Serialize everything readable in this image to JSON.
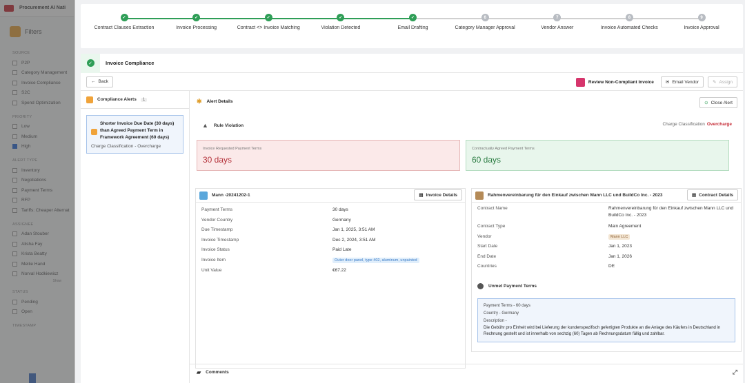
{
  "app": {
    "title": "Procurement AI Nati"
  },
  "filters": {
    "title": "Filters",
    "sections": [
      {
        "heading": "SOURCE",
        "items": [
          {
            "label": "P2P",
            "checked": false
          },
          {
            "label": "Category Management",
            "checked": false
          },
          {
            "label": "Invoice Compliance",
            "checked": false
          },
          {
            "label": "S2C",
            "checked": false
          },
          {
            "label": "Spend Optimization",
            "checked": false
          }
        ]
      },
      {
        "heading": "PRIORITY",
        "items": [
          {
            "label": "Low",
            "checked": false
          },
          {
            "label": "Medium",
            "checked": false
          },
          {
            "label": "High",
            "checked": true
          }
        ]
      },
      {
        "heading": "ALERT TYPE",
        "items": [
          {
            "label": "Inventory",
            "checked": false
          },
          {
            "label": "Negotiations",
            "checked": false
          },
          {
            "label": "Payment Terms",
            "checked": false
          },
          {
            "label": "RFP",
            "checked": false
          },
          {
            "label": "Tariffs: Cheaper Alternat",
            "checked": false
          }
        ]
      },
      {
        "heading": "ASSIGNEE",
        "items": [
          {
            "label": "Adan Stouber",
            "checked": false
          },
          {
            "label": "Alisha Fay",
            "checked": false
          },
          {
            "label": "Krista Beatty",
            "checked": false
          },
          {
            "label": "Mellie Hand",
            "checked": false
          },
          {
            "label": "Norval Hodkiewicz",
            "checked": false
          }
        ],
        "more": "Show"
      },
      {
        "heading": "STATUS",
        "items": [
          {
            "label": "Pending",
            "checked": false
          },
          {
            "label": "Open",
            "checked": false
          }
        ]
      },
      {
        "heading": "TIMESTAMP",
        "items": []
      }
    ]
  },
  "stepper": {
    "steps": [
      {
        "label": "Contract Clauses Extraction",
        "status": "done",
        "num": "✓"
      },
      {
        "label": "Invoice Processing",
        "status": "done",
        "num": "✓"
      },
      {
        "label": "Contract <> Invoice Matching",
        "status": "done",
        "num": "✓"
      },
      {
        "label": "Violation Detected",
        "status": "done",
        "num": "✓"
      },
      {
        "label": "Email Drafting",
        "status": "done",
        "num": "✓"
      },
      {
        "label": "Category Manager Approval",
        "status": "todo",
        "num": "6"
      },
      {
        "label": "Vendor Answer",
        "status": "todo",
        "num": "7"
      },
      {
        "label": "Invoice Automated Checks",
        "status": "todo",
        "num": "8"
      },
      {
        "label": "Invoice Approval",
        "status": "todo",
        "num": "9"
      }
    ]
  },
  "header": {
    "title": "Invoice Compliance"
  },
  "toolbar": {
    "back": "Back",
    "review": "Review Non-Compliant Invoice",
    "email": "Email Vendor",
    "assign": "Assign"
  },
  "alerts": {
    "title": "Compliance Alerts",
    "count": "1",
    "items": [
      {
        "text": "Shorter Invoice Due Date  (30 days) than Agreed Payment Term in Framework Agreement (60 days)",
        "sub": "Charge Classification - Overcharge"
      }
    ]
  },
  "details": {
    "title": "Alert Details",
    "close": "Close Alert",
    "rule": "Rule Violation",
    "charge_label": "Charge Classification",
    "charge_value": "Overcharge",
    "invoice_term_label": "Invoice Requested Payment Terms",
    "invoice_term_value": "30 days",
    "contract_term_label": "Contractually Agreed Payment Terms",
    "contract_term_value": "60 days"
  },
  "invoice": {
    "title": "Mann -20241202-1",
    "button": "Invoice Details",
    "rows": [
      {
        "k": "Payment Terms",
        "v": "30 days"
      },
      {
        "k": "Vendor Country",
        "v": "Germany"
      },
      {
        "k": "Due Timestamp",
        "v": "Jan 1, 2025, 3:51 AM"
      },
      {
        "k": "Invoice Timestamp",
        "v": "Dec 2, 2024, 3:51 AM"
      },
      {
        "k": "Invoice Status",
        "v": "Paid Late"
      },
      {
        "k": "Invoice Item",
        "v": "Outer door panel, type 402, aluminum, unpainted",
        "chip": true
      },
      {
        "k": "Unit Value",
        "v": "€67.22"
      }
    ]
  },
  "contract": {
    "title": "Rahmenvereinbarung für den Einkauf zwischen Mann LLC und BuildCo Inc. - 2023",
    "button": "Contract Details",
    "rows": [
      {
        "k": "Contract Name",
        "v": "Rahmenvereinbarung für den Einkauf zwischen Mann LLC und BuildCo Inc. - 2023",
        "tall": true
      },
      {
        "k": "Contract Type",
        "v": "Main Agreement"
      },
      {
        "k": "Vendor",
        "v": "Mann LLC",
        "chip": true
      },
      {
        "k": "Start Date",
        "v": "Jan 1, 2023"
      },
      {
        "k": "End Date",
        "v": "Jan 1, 2026"
      },
      {
        "k": "Countries",
        "v": "DE"
      }
    ],
    "unmet_title": "Unmet Payment Terms",
    "unmet_terms": "Payment Terms - 60 days",
    "unmet_country": "Country - Germany",
    "unmet_desc_label": "Description -",
    "unmet_desc": "Die Gebühr pro Einheit wird bei Lieferung der kundenspezifisch gefertigten Produkte an die Anlage des Käufers in Deutschland in Rechnung gestellt und ist innerhalb von sechzig (60) Tagen ab Rechnungsdatum fällig und zahlbar."
  },
  "comments": {
    "title": "Comments"
  }
}
